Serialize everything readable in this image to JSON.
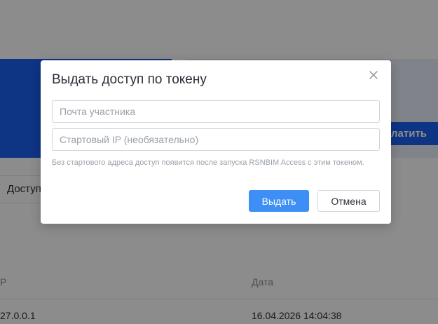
{
  "background": {
    "pay_button_label": "латить",
    "access_tab_label": "Доступ",
    "table": {
      "columns": [
        "P",
        "Дата"
      ],
      "rows": [
        [
          "27.0.0.1",
          "16.04.2026 14:04:38"
        ]
      ]
    }
  },
  "modal": {
    "title": "Выдать доступ по токену",
    "close_icon": "close-icon",
    "email_placeholder": "Почта участника",
    "email_value": "",
    "ip_placeholder": "Стартовый IP (необязательно)",
    "ip_value": "",
    "hint": "Без стартового адреса доступ появится после запуска RSNBIM Access с этим токеном.",
    "submit_label": "Выдать",
    "cancel_label": "Отмена"
  },
  "colors": {
    "primary": "#3d8ef5",
    "brand_blue": "#1a5ff0",
    "overlay": "rgba(0,0,0,0.45)"
  }
}
